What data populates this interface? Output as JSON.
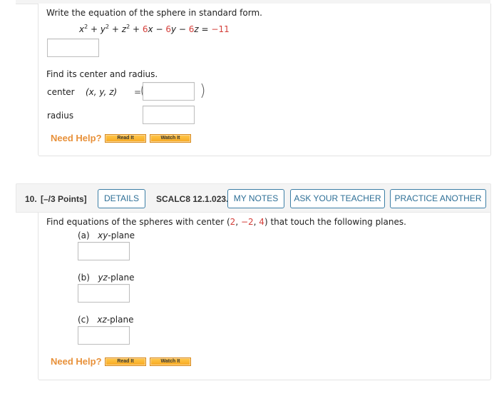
{
  "question9": {
    "prompt": "Write the equation of the sphere in standard form.",
    "equation": {
      "lhs_terms": [
        "x",
        "2",
        " + ",
        "y",
        "2",
        " + ",
        "z",
        "2",
        " + "
      ],
      "t1": "6",
      "t1_var": "x",
      "op2": " − ",
      "t2": "6",
      "t2_var": "y",
      "op3": " − ",
      "t3": "6",
      "t3_var": "z",
      "eq": " = ",
      "rhs": "−11"
    },
    "standard_form_answer": "",
    "center_radius_prompt": "Find its center and radius.",
    "center_label": "center",
    "center_vars": "(x, y, z)",
    "equals": "=",
    "open_paren": "(",
    "close_paren": ")",
    "center_answer": "",
    "radius_label": "radius",
    "radius_answer": "",
    "need_help": "Need Help?",
    "read_it": "Read It",
    "watch_it": "Watch It"
  },
  "question10": {
    "number": "10.",
    "points": "[–/3 Points]",
    "details_label": "DETAILS",
    "code": "SCALC8 12.1.023.",
    "my_notes_label": "MY NOTES",
    "ask_teacher_label": "ASK YOUR TEACHER",
    "practice_another_label": "PRACTICE ANOTHER",
    "prompt_before": "Find equations of the spheres with center ",
    "center": {
      "open": "(",
      "x": "2",
      "sep1": ", ",
      "y": "−2",
      "sep2": ", ",
      "z": "4",
      "close": ")"
    },
    "prompt_after": " that touch the following planes.",
    "parts": [
      {
        "letter": "(a)",
        "plane_var": "xy",
        "plane_suffix": "-plane",
        "answer": ""
      },
      {
        "letter": "(b)",
        "plane_var": "yz",
        "plane_suffix": "-plane",
        "answer": ""
      },
      {
        "letter": "(c)",
        "plane_var": "xz",
        "plane_suffix": "-plane",
        "answer": ""
      }
    ],
    "need_help": "Need Help?",
    "read_it": "Read It",
    "watch_it": "Watch It"
  },
  "colors": {
    "accent_red": "#d43f3a",
    "button_blue": "#2e6f96",
    "need_help_orange": "#e8913a",
    "help_button_fill": "#f7a822"
  }
}
